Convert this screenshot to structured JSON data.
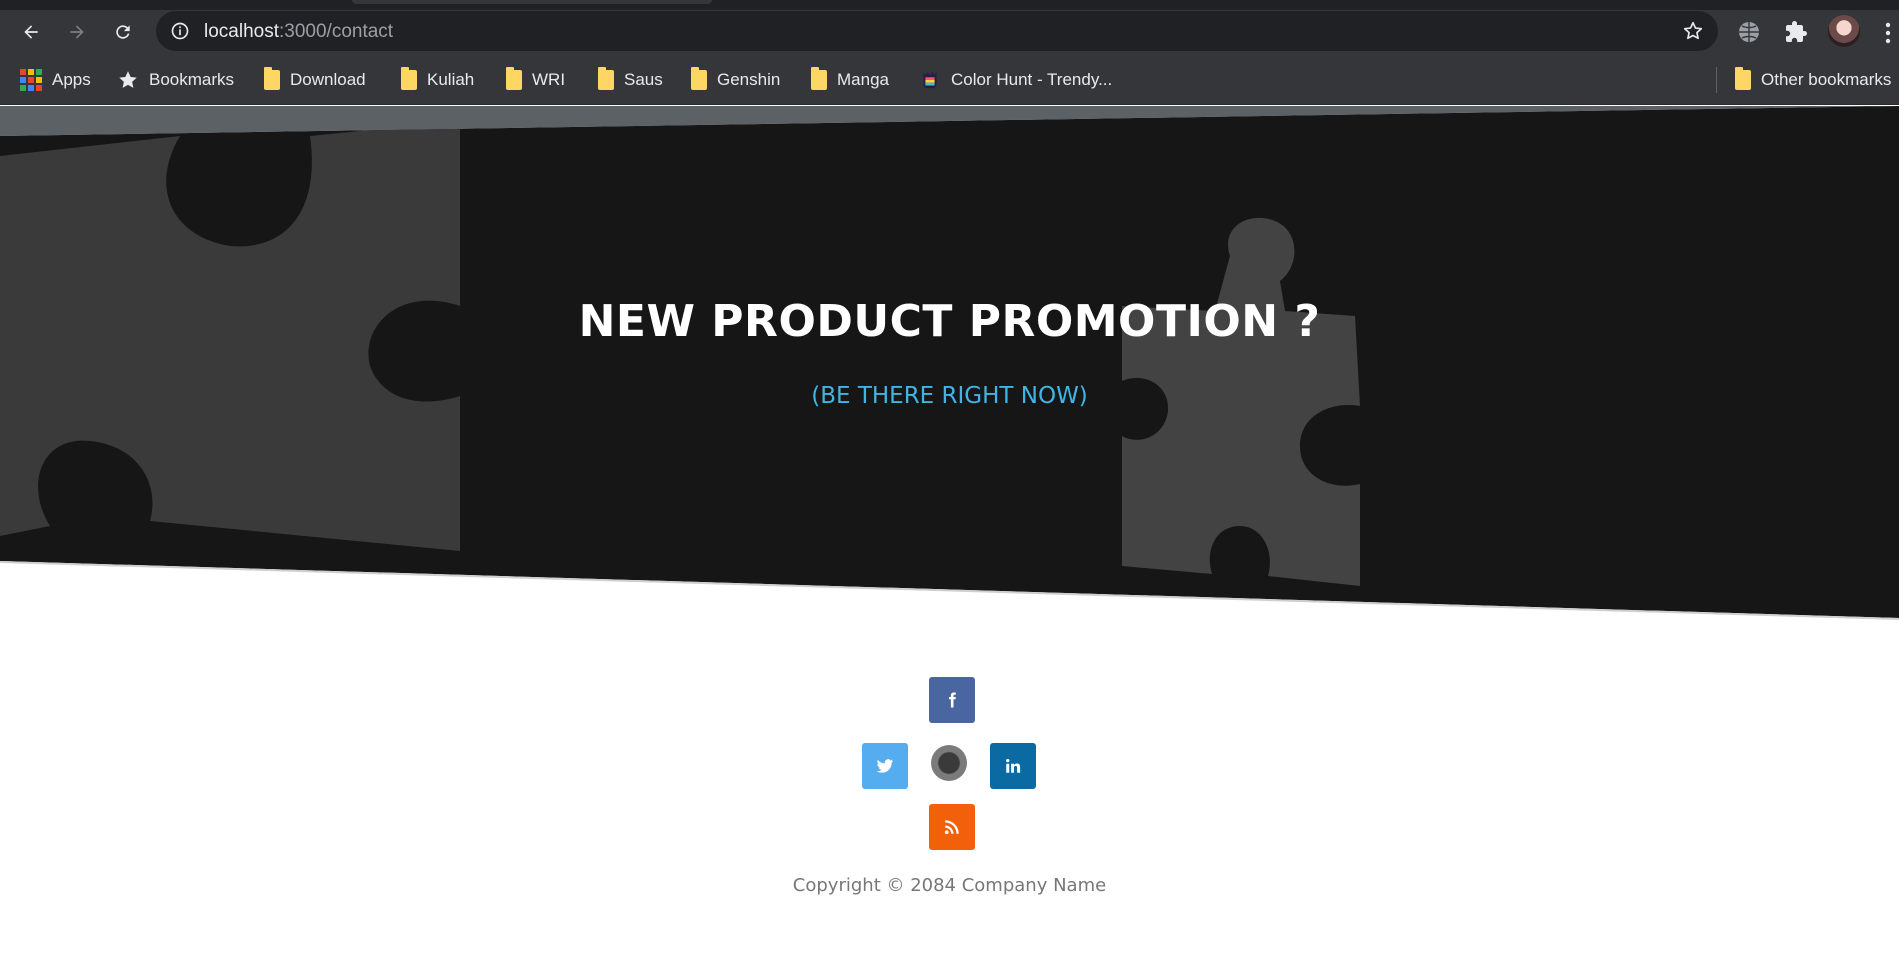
{
  "browser": {
    "url_host": "localhost",
    "url_path": ":3000/contact"
  },
  "bookmarks": {
    "items": [
      {
        "label": "Apps",
        "icon": "apps-grid-icon"
      },
      {
        "label": "Bookmarks",
        "icon": "star-icon"
      },
      {
        "label": "Download",
        "icon": "folder-icon"
      },
      {
        "label": "Kuliah",
        "icon": "folder-icon"
      },
      {
        "label": "WRI",
        "icon": "folder-icon"
      },
      {
        "label": "Saus",
        "icon": "folder-icon"
      },
      {
        "label": "Genshin",
        "icon": "folder-icon"
      },
      {
        "label": "Manga",
        "icon": "folder-icon"
      },
      {
        "label": "Color Hunt - Trendy...",
        "icon": "color-hunt-icon"
      }
    ],
    "other": "Other bookmarks"
  },
  "hero": {
    "title": "NEW PRODUCT PROMOTION ?",
    "subtitle": "(BE THERE RIGHT NOW)"
  },
  "social": {
    "facebook": {
      "glyph": "f",
      "color": "#4a66a0"
    },
    "twitter": {
      "glyph": "t",
      "color": "#55acee"
    },
    "linkedin": {
      "glyph": "in",
      "color": "#0a6aa1"
    },
    "rss": {
      "glyph": "rss",
      "color": "#f26109"
    }
  },
  "footer": {
    "copyright": "Copyright © 2084 Company Name"
  }
}
